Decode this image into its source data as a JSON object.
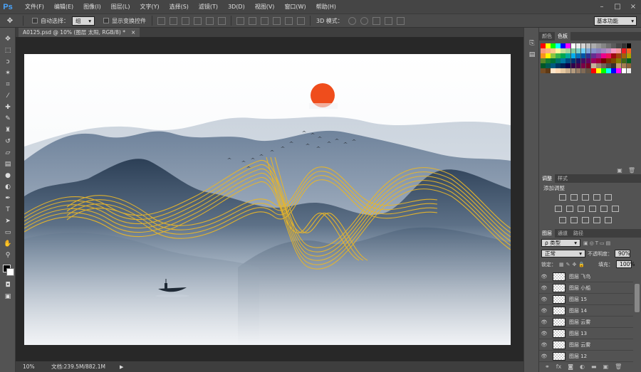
{
  "app": {
    "logo": "Ps"
  },
  "menu": [
    "文件(F)",
    "编辑(E)",
    "图像(I)",
    "图层(L)",
    "文字(Y)",
    "选择(S)",
    "滤镜(T)",
    "3D(D)",
    "视图(V)",
    "窗口(W)",
    "帮助(H)"
  ],
  "window_controls": [
    "–",
    "□",
    "×"
  ],
  "options": {
    "auto_select_label": "自动选择：",
    "auto_select_value": "组",
    "show_transform_label": "显示变换控件",
    "mode_3d_label": "3D 模式："
  },
  "workspace": "基本功能",
  "document": {
    "tab_title": "A0125.psd @ 10% (图层 太阳, RGB/8) *",
    "zoom": "10%",
    "doc_info": "文档:239.5M/882.1M"
  },
  "panels": {
    "color_tabs": [
      "颜色",
      "色板"
    ],
    "adjust_tabs": [
      "调整",
      "样式"
    ],
    "adjust_title": "添加调整",
    "layer_tabs": [
      "图层",
      "通道",
      "路径"
    ],
    "filter_kind": "ρ 类型",
    "blend_mode": "正常",
    "opacity_label": "不透明度：",
    "opacity_value": "90%",
    "lock_label": "锁定：",
    "fill_label": "填充：",
    "fill_value": "100%"
  },
  "layers": [
    {
      "name": "图层 飞鸟"
    },
    {
      "name": "图层 小船"
    },
    {
      "name": "图层 15"
    },
    {
      "name": "图层 14"
    },
    {
      "name": "图层 云雾"
    },
    {
      "name": "图层 13"
    },
    {
      "name": "图层 云雾"
    },
    {
      "name": "图层 12"
    }
  ],
  "colors": {
    "sun": "#ef4d1c",
    "gold": "#e8b62a",
    "mountain_dark": "#2f4258",
    "mountain_mid": "#6b8098"
  }
}
